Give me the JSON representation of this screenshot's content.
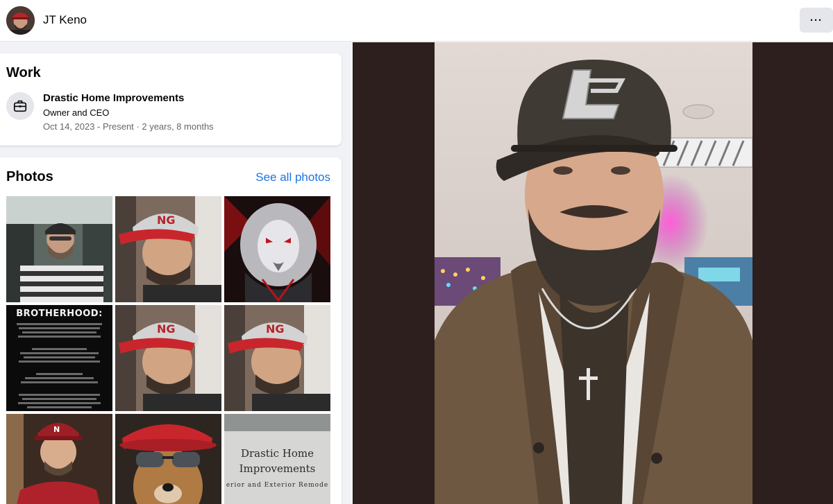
{
  "header": {
    "profile_name": "JT Keno",
    "avatar_icon": "profile-avatar",
    "more_label": "···"
  },
  "work": {
    "title": "Work",
    "icon": "briefcase-icon",
    "company": "Drastic Home Improvements",
    "role": "Owner and CEO",
    "dates": "Oct 14, 2023 - Present · 2 years, 8 months"
  },
  "photos": {
    "title": "Photos",
    "see_all": "See all photos",
    "brotherhood_heading": "BROTHERHOOD:",
    "sign_line1": "Drastic Home",
    "sign_line2": "Improvements",
    "sign_line3": "erior and Exterior Remode"
  },
  "colors": {
    "link": "#1b74e4",
    "viewer_background": "#2d1f1e",
    "secondary_text": "#65676b"
  }
}
